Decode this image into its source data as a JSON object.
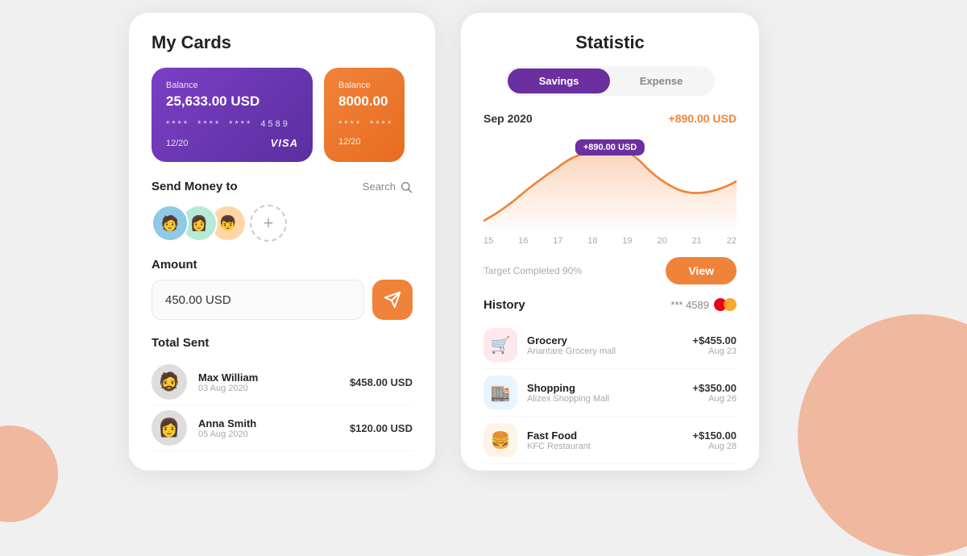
{
  "app": {
    "bg_left_color": "#f0a07a",
    "bg_right_color": "#f0a07a"
  },
  "left_panel": {
    "title": "My Cards",
    "card1": {
      "label": "Balance",
      "amount": "25,633.00 USD",
      "dots": [
        "****",
        "****",
        "****",
        "4589"
      ],
      "expiry": "12/20",
      "brand": "VISA"
    },
    "card2": {
      "label": "Balance",
      "amount": "8000.00",
      "dots": [
        "****",
        "****"
      ],
      "expiry": "12/20"
    },
    "send_money": {
      "title": "Send Money to",
      "search_label": "Search",
      "avatars": [
        "🧑",
        "👩",
        "👦"
      ],
      "add_label": "+"
    },
    "amount": {
      "label": "Amount",
      "value": "450.00 USD",
      "placeholder": "450.00 USD",
      "send_icon": "➤"
    },
    "total_sent": {
      "title": "Total Sent",
      "items": [
        {
          "name": "Max William",
          "date": "03 Aug 2020",
          "amount": "$458.00 USD"
        },
        {
          "name": "Anna Smith",
          "date": "05 Aug 2020",
          "amount": "$120.00 USD"
        }
      ]
    }
  },
  "right_panel": {
    "title": "Statistic",
    "tabs": [
      {
        "label": "Savings",
        "active": true
      },
      {
        "label": "Expense",
        "active": false
      }
    ],
    "chart": {
      "month": "Sep 2020",
      "value": "+890.00 USD",
      "tooltip": "+890.00 USD",
      "labels": [
        "15",
        "16",
        "17",
        "18",
        "19",
        "20",
        "21",
        "22"
      ]
    },
    "target": {
      "text": "Target Completed 90%",
      "view_label": "View"
    },
    "history": {
      "title": "History",
      "card_info": "*** 4589",
      "items": [
        {
          "name": "Grocery",
          "sub": "Ariantare Grocery mall",
          "amount": "+$455.00",
          "date": "Aug 23",
          "icon": "🛒",
          "icon_class": "hist-icon-grocery"
        },
        {
          "name": "Shopping",
          "sub": "Alizex Shopping Mall",
          "amount": "+$350.00",
          "date": "Aug 26",
          "icon": "🏬",
          "icon_class": "hist-icon-shopping"
        },
        {
          "name": "Fast Food",
          "sub": "KFC Restaurant",
          "amount": "+$150.00",
          "date": "Aug 28",
          "icon": "🍔",
          "icon_class": "hist-icon-food"
        }
      ]
    }
  }
}
